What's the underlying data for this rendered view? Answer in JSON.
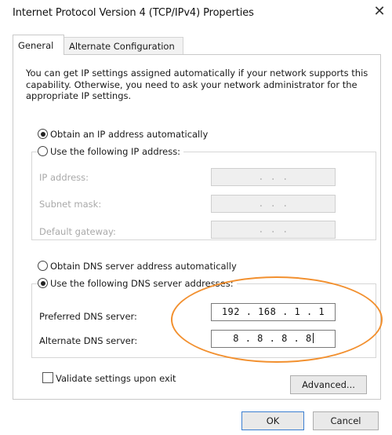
{
  "window": {
    "title": "Internet Protocol Version 4 (TCP/IPv4) Properties",
    "close_label": "✕"
  },
  "tabs": [
    {
      "label": "General",
      "active": true
    },
    {
      "label": "Alternate Configuration",
      "active": false
    }
  ],
  "description": "You can get IP settings assigned automatically if your network supports this capability. Otherwise, you need to ask your network administrator for the appropriate IP settings.",
  "ip_mode": {
    "auto_label": "Obtain an IP address automatically",
    "auto_checked": true,
    "manual_label": "Use the following IP address:",
    "manual_checked": false
  },
  "ip_fields": {
    "ip_address_label": "IP address:",
    "ip_address_value": ".   .   .",
    "subnet_label": "Subnet mask:",
    "subnet_value": ".   .   .",
    "gateway_label": "Default gateway:",
    "gateway_value": ".   .   ."
  },
  "dns_mode": {
    "auto_label": "Obtain DNS server address automatically",
    "auto_checked": false,
    "manual_label": "Use the following DNS server addresses:",
    "manual_checked": true
  },
  "dns_fields": {
    "preferred_label": "Preferred DNS server:",
    "preferred_value": "192 . 168 .  1  .  1",
    "alternate_label": "Alternate DNS server:",
    "alternate_value": "8  .  8  .  8  .  8"
  },
  "validate": {
    "label": "Validate settings upon exit",
    "checked": false
  },
  "buttons": {
    "advanced": "Advanced...",
    "ok": "OK",
    "cancel": "Cancel"
  },
  "colors": {
    "highlight_oval": "#f2902f",
    "ok_border": "#3c7fd1"
  }
}
